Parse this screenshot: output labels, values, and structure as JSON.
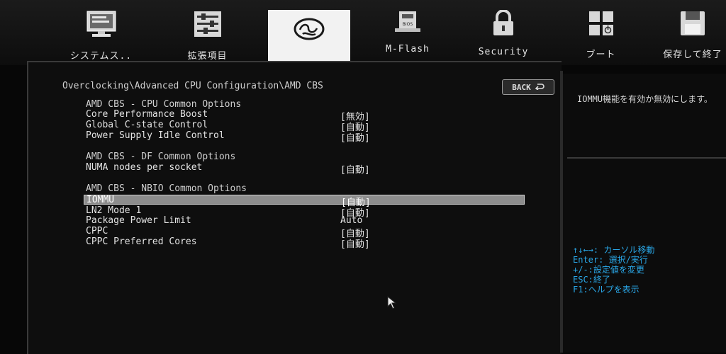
{
  "tabs": {
    "system": "システムス..",
    "settings": "拡張項目",
    "oc": "",
    "mflash": "M-Flash",
    "security": "Security",
    "boot": "ブート",
    "save": "保存して終了"
  },
  "breadcrumb": "Overclocking\\Advanced CPU Configuration\\AMD CBS",
  "back_label": "BACK",
  "sections": {
    "cpu": "AMD CBS - CPU Common Options",
    "df": "AMD CBS - DF Common Options",
    "nbio": "AMD CBS - NBIO Common Options"
  },
  "rows": [
    {
      "label": "Core Performance Boost",
      "value": "[無効]"
    },
    {
      "label": "Global C-state Control",
      "value": "[自動]"
    },
    {
      "label": "Power Supply Idle Control",
      "value": "[自動]"
    },
    {
      "label": "NUMA nodes per socket",
      "value": "[自動]"
    },
    {
      "label": "IOMMU",
      "value": "[自動]"
    },
    {
      "label": "LN2 Mode 1",
      "value": "[自動]"
    },
    {
      "label": "Package Power Limit",
      "value": "Auto"
    },
    {
      "label": "CPPC",
      "value": "[自動]"
    },
    {
      "label": "CPPC Preferred Cores",
      "value": "[自動]"
    }
  ],
  "help": {
    "description": "IOMMU機能を有効か無効にします。",
    "keys": [
      "↑↓←→: カーソル移動",
      "Enter: 選択/実行",
      "+/-:設定値を変更",
      "ESC:終了",
      "F1:ヘルプを表示"
    ]
  },
  "colors": {
    "background": "#070707",
    "active_tab": "#f2f2f2",
    "selected_row": "#8d8d8d",
    "key_help": "#2aa8e8"
  }
}
